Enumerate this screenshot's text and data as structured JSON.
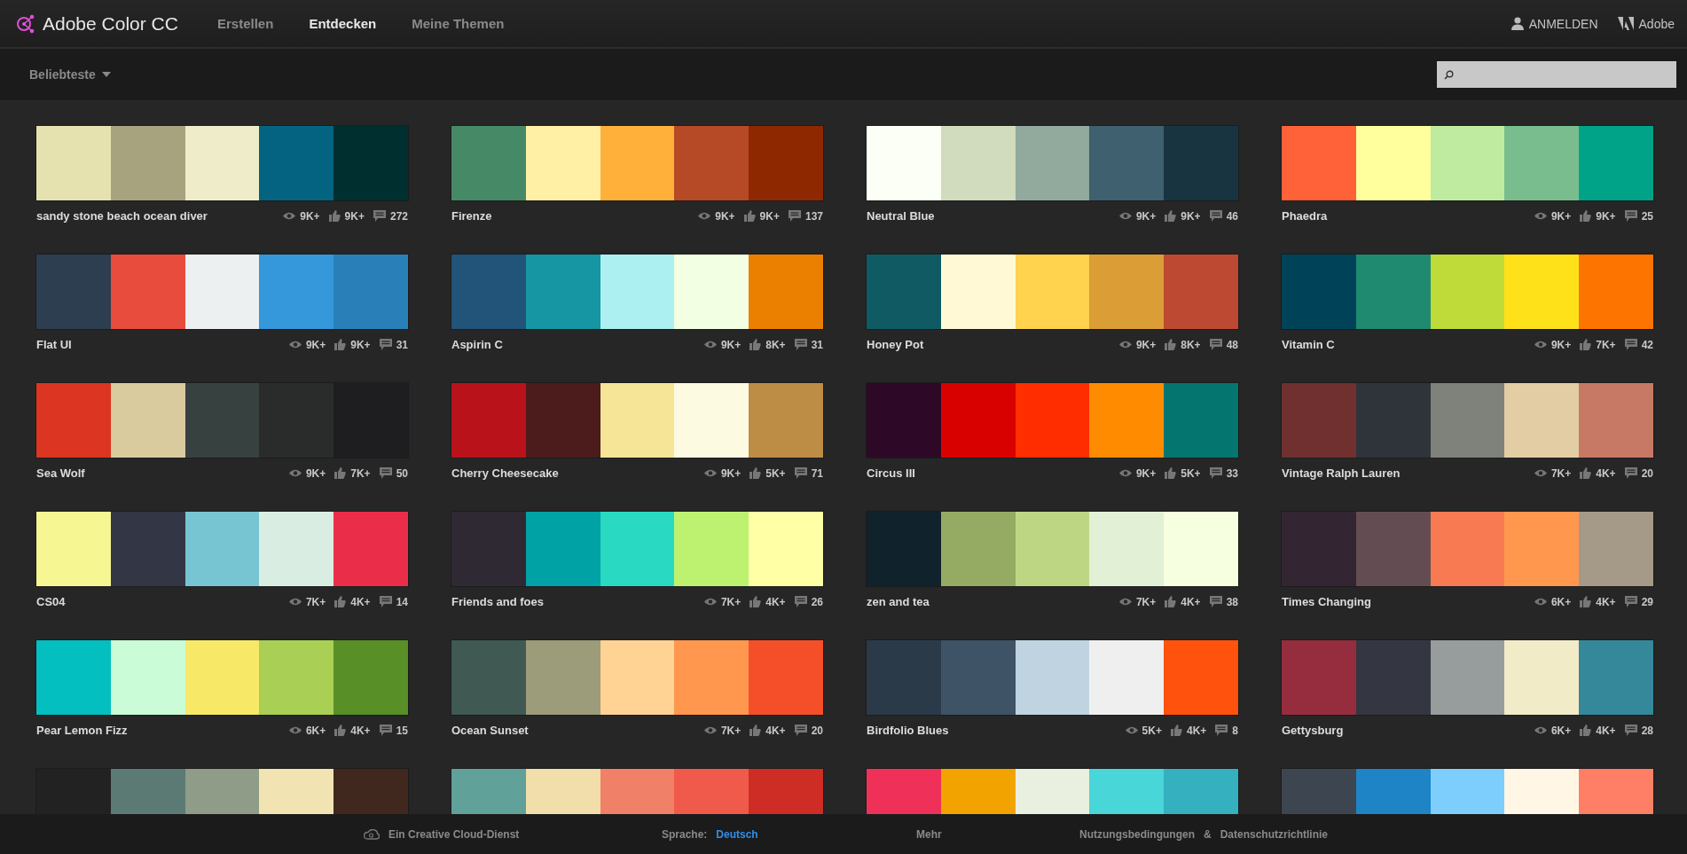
{
  "header": {
    "logo_text": "Adobe Color CC",
    "nav": [
      {
        "label": "Erstellen",
        "selected": false
      },
      {
        "label": "Entdecken",
        "selected": true
      },
      {
        "label": "Meine Themen",
        "selected": false
      }
    ],
    "sign_in": "ANMELDEN",
    "brand": "Adobe"
  },
  "toolbar": {
    "sort_label": "Beliebteste"
  },
  "themes": [
    {
      "name": "sandy stone beach ocean diver",
      "swatches": [
        {
          "color": "#e6e2af"
        },
        {
          "color": "#a7a37e"
        },
        {
          "color": "#efecca"
        },
        {
          "color": "#046380"
        },
        {
          "color": "#002f2f"
        }
      ],
      "views": "9K+",
      "likes": "9K+",
      "comments": "272"
    },
    {
      "name": "Firenze",
      "swatches": [
        {
          "color": "#468966"
        },
        {
          "color": "#fff0a5"
        },
        {
          "color": "#ffb03b"
        },
        {
          "color": "#b64926"
        },
        {
          "color": "#8e2800"
        }
      ],
      "views": "9K+",
      "likes": "9K+",
      "comments": "137"
    },
    {
      "name": "Neutral Blue",
      "swatches": [
        {
          "color": "#fcfff5"
        },
        {
          "color": "#d1dbbd"
        },
        {
          "color": "#91aa9d"
        },
        {
          "color": "#3e606f"
        },
        {
          "color": "#193441"
        }
      ],
      "views": "9K+",
      "likes": "9K+",
      "comments": "46"
    },
    {
      "name": "Phaedra",
      "swatches": [
        {
          "color": "#ff6138"
        },
        {
          "color": "#ffff9d"
        },
        {
          "color": "#beeb9f"
        },
        {
          "color": "#79bd8f"
        },
        {
          "color": "#00a388"
        }
      ],
      "views": "9K+",
      "likes": "9K+",
      "comments": "25"
    },
    {
      "name": "Flat UI",
      "swatches": [
        {
          "color": "#2c3e50"
        },
        {
          "color": "#e74c3c"
        },
        {
          "color": "#ecf0f1"
        },
        {
          "color": "#3498db"
        },
        {
          "color": "#2980b9"
        }
      ],
      "views": "9K+",
      "likes": "9K+",
      "comments": "31"
    },
    {
      "name": "Aspirin C",
      "swatches": [
        {
          "color": "#225378"
        },
        {
          "color": "#1695a3"
        },
        {
          "color": "#acf0f2"
        },
        {
          "color": "#f3ffe2"
        },
        {
          "color": "#eb7f00"
        }
      ],
      "views": "9K+",
      "likes": "8K+",
      "comments": "31"
    },
    {
      "name": "Honey Pot",
      "swatches": [
        {
          "color": "#105b63"
        },
        {
          "color": "#fffad5"
        },
        {
          "color": "#ffd34e"
        },
        {
          "color": "#db9e36"
        },
        {
          "color": "#bd4932"
        }
      ],
      "views": "9K+",
      "likes": "8K+",
      "comments": "48"
    },
    {
      "name": "Vitamin C",
      "swatches": [
        {
          "color": "#004358"
        },
        {
          "color": "#1f8a70"
        },
        {
          "color": "#bedb39"
        },
        {
          "color": "#ffe11a"
        },
        {
          "color": "#fd7400"
        }
      ],
      "views": "9K+",
      "likes": "7K+",
      "comments": "42"
    },
    {
      "name": "Sea Wolf",
      "swatches": [
        {
          "color": "#dc3522"
        },
        {
          "color": "#d9cb9e"
        },
        {
          "color": "#374140"
        },
        {
          "color": "#2a2c2b"
        },
        {
          "color": "#1e1e20"
        }
      ],
      "views": "9K+",
      "likes": "7K+",
      "comments": "50"
    },
    {
      "name": "Cherry Cheesecake",
      "swatches": [
        {
          "color": "#b9121b"
        },
        {
          "color": "#4c1b1b"
        },
        {
          "color": "#f6e497"
        },
        {
          "color": "#fcfae1"
        },
        {
          "color": "#bd8d46"
        }
      ],
      "views": "9K+",
      "likes": "5K+",
      "comments": "71"
    },
    {
      "name": "Circus III",
      "swatches": [
        {
          "color": "#2e0927"
        },
        {
          "color": "#d90000"
        },
        {
          "color": "#ff2d00"
        },
        {
          "color": "#ff8c00"
        },
        {
          "color": "#04756f"
        }
      ],
      "views": "9K+",
      "likes": "5K+",
      "comments": "33"
    },
    {
      "name": "Vintage Ralph Lauren",
      "swatches": [
        {
          "color": "#703030"
        },
        {
          "color": "#2f343b"
        },
        {
          "color": "#7e827a"
        },
        {
          "color": "#e3cda4"
        },
        {
          "color": "#c77966"
        }
      ],
      "views": "7K+",
      "likes": "4K+",
      "comments": "20"
    },
    {
      "name": "CS04",
      "swatches": [
        {
          "color": "#f6f792"
        },
        {
          "color": "#333745"
        },
        {
          "color": "#77c4d3"
        },
        {
          "color": "#daede2"
        },
        {
          "color": "#ea2e49"
        }
      ],
      "views": "7K+",
      "likes": "4K+",
      "comments": "14"
    },
    {
      "name": "Friends and foes",
      "swatches": [
        {
          "color": "#2f2933"
        },
        {
          "color": "#01a2a6"
        },
        {
          "color": "#29d9c2"
        },
        {
          "color": "#bdf271"
        },
        {
          "color": "#ffffa6"
        }
      ],
      "views": "7K+",
      "likes": "4K+",
      "comments": "26"
    },
    {
      "name": "zen and tea",
      "swatches": [
        {
          "color": "#10222b"
        },
        {
          "color": "#95ab63"
        },
        {
          "color": "#bdd684"
        },
        {
          "color": "#e2f0d6"
        },
        {
          "color": "#f6ffe0"
        }
      ],
      "views": "7K+",
      "likes": "4K+",
      "comments": "38"
    },
    {
      "name": "Times Changing",
      "swatches": [
        {
          "color": "#332532"
        },
        {
          "color": "#644d52"
        },
        {
          "color": "#f77a52"
        },
        {
          "color": "#ff974f"
        },
        {
          "color": "#a49a87"
        }
      ],
      "views": "6K+",
      "likes": "4K+",
      "comments": "29"
    },
    {
      "name": "Pear Lemon Fizz",
      "swatches": [
        {
          "color": "#04bfbf"
        },
        {
          "color": "#cafcd8"
        },
        {
          "color": "#f7e967"
        },
        {
          "color": "#a9cf54"
        },
        {
          "color": "#588f27"
        }
      ],
      "views": "6K+",
      "likes": "4K+",
      "comments": "15"
    },
    {
      "name": "Ocean Sunset",
      "swatches": [
        {
          "color": "#405952"
        },
        {
          "color": "#9c9b7a"
        },
        {
          "color": "#ffd393"
        },
        {
          "color": "#ff974f"
        },
        {
          "color": "#f54f29"
        }
      ],
      "views": "7K+",
      "likes": "4K+",
      "comments": "20"
    },
    {
      "name": "Birdfolio Blues",
      "swatches": [
        {
          "color": "#2a3a48"
        },
        {
          "color": "#3e5366"
        },
        {
          "color": "#bfd4e0"
        },
        {
          "color": "#efefef"
        },
        {
          "color": "#ff530d"
        }
      ],
      "views": "5K+",
      "likes": "4K+",
      "comments": "8"
    },
    {
      "name": "Gettysburg",
      "swatches": [
        {
          "color": "#962d3e"
        },
        {
          "color": "#343642"
        },
        {
          "color": "#979c9c"
        },
        {
          "color": "#f2ebc7"
        },
        {
          "color": "#348899"
        }
      ],
      "views": "6K+",
      "likes": "4K+",
      "comments": "28"
    },
    {
      "swatches": [
        {
          "color": "#222222"
        },
        {
          "color": "#5c7a74"
        },
        {
          "color": "#8e9c88"
        },
        {
          "color": "#f2e3b3"
        },
        {
          "color": "#40281f"
        }
      ]
    },
    {
      "swatches": [
        {
          "color": "#60a29a"
        },
        {
          "color": "#f2deab"
        },
        {
          "color": "#f08068"
        },
        {
          "color": "#f05a4a"
        },
        {
          "color": "#cd2d25"
        }
      ]
    },
    {
      "swatches": [
        {
          "color": "#ef3159"
        },
        {
          "color": "#f3a300"
        },
        {
          "color": "#e9f0df"
        },
        {
          "color": "#48d6d8"
        },
        {
          "color": "#35b0be"
        }
      ]
    },
    {
      "swatches": [
        {
          "color": "#3d4550"
        },
        {
          "color": "#1e84c6"
        },
        {
          "color": "#7ecefd"
        },
        {
          "color": "#fff6e5"
        },
        {
          "color": "#ff7f66"
        }
      ]
    }
  ],
  "footer": {
    "service": "Ein Creative Cloud-Dienst",
    "language_label": "Sprache:",
    "language": "Deutsch",
    "more": "Mehr",
    "terms": "Nutzungsbedingungen",
    "amp": "&",
    "privacy": "Datenschutzrichtlinie"
  }
}
